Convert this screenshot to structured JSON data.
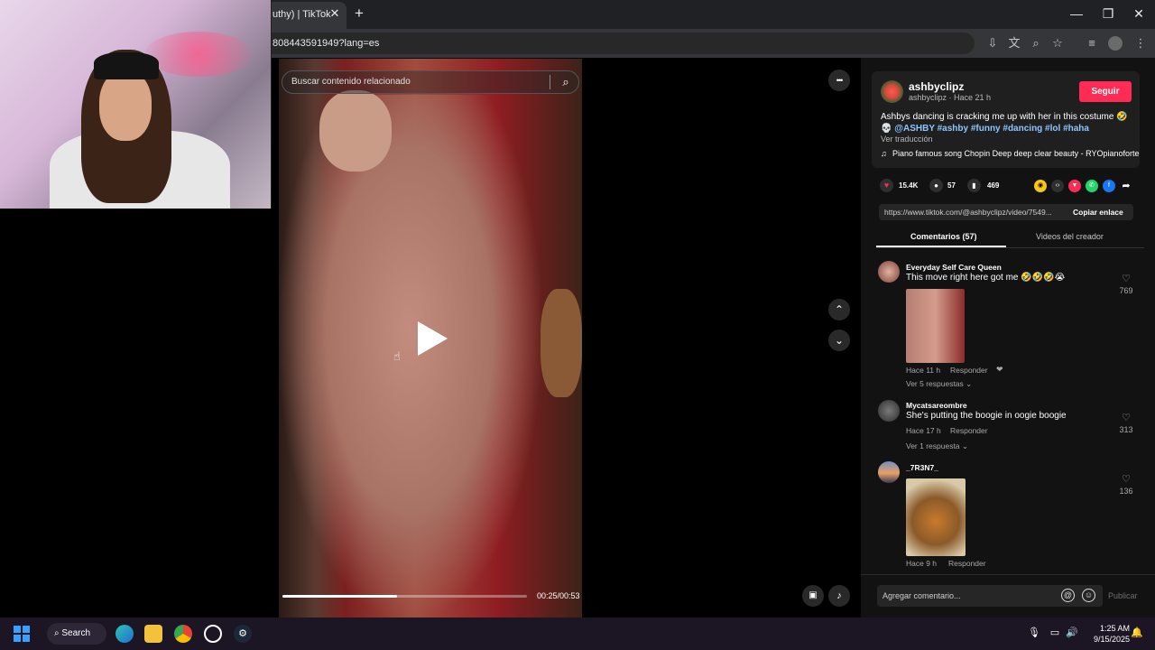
{
  "browser": {
    "tab_title": "uthy) | TikTok",
    "tab_close": "✕",
    "new_tab": "+",
    "url": "808443591949?lang=es",
    "window_buttons": [
      "—",
      "❐",
      "✕"
    ]
  },
  "player": {
    "search_placeholder": "Buscar contenido relacionado",
    "more_label": "•••",
    "time": "00:25/00:53",
    "progress": 0.47,
    "up_label": "⌃",
    "down_label": "⌄"
  },
  "creator": {
    "username": "ashbyclipz",
    "meta": "ashbyclipz · Hace 21 h",
    "follow": "Seguir",
    "description": "Ashbys dancing is cracking me up with her in this costume 🤣 💀",
    "hashtags": "@ASHBY #ashby #funny #dancing #lol #haha",
    "translate": "Ver traducción",
    "music": "Piano famous song Chopin Deep deep clear beauty - RYOpianoforte"
  },
  "stats": {
    "likes": "15.4K",
    "comments": "57",
    "saves": "469"
  },
  "share": {
    "link": "https://www.tiktok.com/@ashbyclipz/video/7549...",
    "copy": "Copiar enlace"
  },
  "tabs": {
    "comments": "Comentarios (57)",
    "videos": "Videos del creador"
  },
  "comments": [
    {
      "name": "Everyday Self Care Queen",
      "text": "This move right here got me 🤣🤣🤣😭",
      "meta": "Hace 11 h",
      "reply": "Responder",
      "replies": "Ver 5 respuestas ⌄",
      "likes": "769"
    },
    {
      "name": "Mycatsareombre",
      "text": "She's putting the boogie in oogie boogie",
      "meta": "Hace 17 h",
      "reply": "Responder",
      "replies": "Ver 1 respuesta ⌄",
      "likes": "313"
    },
    {
      "name": "_7R3N7_",
      "text": "",
      "meta": "Hace 9 h",
      "reply": "Responder",
      "replies": "",
      "likes": "136"
    }
  ],
  "composer": {
    "placeholder": "Agregar comentario...",
    "post": "Publicar"
  },
  "taskbar": {
    "search": "Search",
    "time": "1:25 AM",
    "date": "9/15/2025"
  },
  "colors": {
    "follow": "#fe2c55",
    "hashtag": "#8ec5ff",
    "panel": "#121212"
  }
}
